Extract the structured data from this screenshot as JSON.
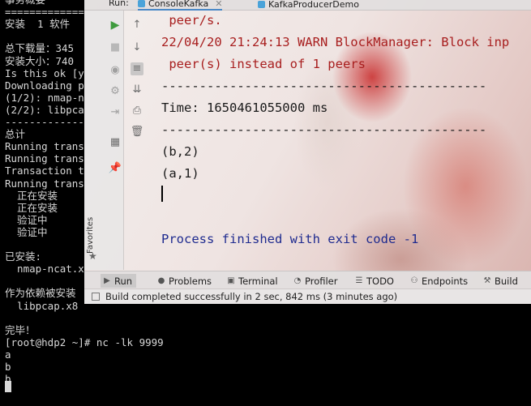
{
  "terminal": {
    "lines": [
      "事务概要",
      "=================",
      "安装  1 软件",
      "",
      "总下载量：345",
      "安装大小：740",
      "Is this ok [y",
      "Downloading p",
      "(1/2): nmap-n",
      "(2/2): libpca",
      "-------------",
      "总计",
      "Running trans",
      "Running trans",
      "Transaction t",
      "Running trans",
      "  正在安装",
      "  正在安装",
      "  验证中",
      "  验证中",
      "",
      "已安装:",
      "  nmap-ncat.x",
      "",
      "作为依赖被安装",
      "  libpcap.x8",
      "",
      "完毕！",
      "[root@hdp2 ~]# nc -lk 9999",
      "a",
      "b",
      "b"
    ]
  },
  "ide": {
    "run_label": "Run:",
    "tabs": [
      {
        "label": "ConsoleKafka",
        "active": true
      },
      {
        "label": "KafkaProducerDemo",
        "active": false
      }
    ],
    "favorites_label": "Favorites",
    "console_lines": [
      {
        "text": " peer/s.",
        "kind": "warn"
      },
      {
        "text": "22/04/20 21:24:13 WARN BlockManager: Block inp",
        "kind": "warn"
      },
      {
        "text": " peer(s) instead of 1 peers",
        "kind": "warn"
      },
      {
        "text": "-------------------------------------------",
        "kind": "plain"
      },
      {
        "text": "Time: 1650461055000 ms",
        "kind": "plain"
      },
      {
        "text": "-------------------------------------------",
        "kind": "plain"
      },
      {
        "text": "(b,2)",
        "kind": "plain"
      },
      {
        "text": "(a,1)",
        "kind": "plain"
      },
      {
        "text": "",
        "kind": "plain"
      },
      {
        "text": "",
        "kind": "plain"
      },
      {
        "text": "Process finished with exit code -1",
        "kind": "exit"
      }
    ],
    "tool_windows": [
      {
        "label": "Run",
        "icon": "run-icon",
        "active": true
      },
      {
        "label": "Problems",
        "icon": "problems-icon",
        "active": false
      },
      {
        "label": "Terminal",
        "icon": "terminal-icon",
        "active": false
      },
      {
        "label": "Profiler",
        "icon": "profiler-icon",
        "active": false
      },
      {
        "label": "TODO",
        "icon": "todo-icon",
        "active": false
      },
      {
        "label": "Endpoints",
        "icon": "endpoints-icon",
        "active": false
      },
      {
        "label": "Build",
        "icon": "build-icon",
        "active": false
      }
    ],
    "status_text": "Build completed successfully in 2 sec, 842 ms (3 minutes ago)",
    "colors": {
      "warn": "#a81e1e",
      "exit": "#1f2b8f",
      "run_green": "#3e9b3e"
    }
  }
}
